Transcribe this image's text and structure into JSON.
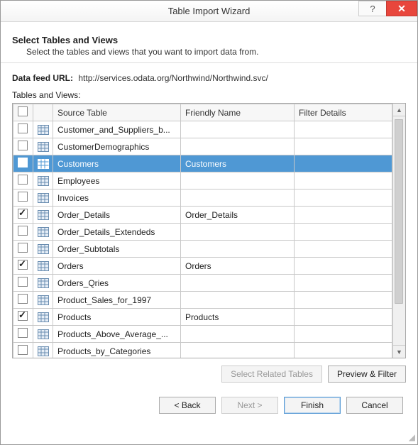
{
  "window": {
    "title": "Table Import Wizard"
  },
  "header": {
    "heading": "Select Tables and Views",
    "subheading": "Select the tables and views that you want to import data from."
  },
  "feed": {
    "label": "Data feed URL:",
    "value": "http://services.odata.org/Northwind/Northwind.svc/"
  },
  "list_label": "Tables and Views:",
  "columns": {
    "source": "Source Table",
    "friendly": "Friendly Name",
    "filter": "Filter Details"
  },
  "rows": [
    {
      "checked": false,
      "selected": false,
      "source": "Customer_and_Suppliers_b...",
      "friendly": "",
      "filter": ""
    },
    {
      "checked": false,
      "selected": false,
      "source": "CustomerDemographics",
      "friendly": "",
      "filter": ""
    },
    {
      "checked": true,
      "selected": true,
      "source": "Customers",
      "friendly": "Customers",
      "filter": ""
    },
    {
      "checked": false,
      "selected": false,
      "source": "Employees",
      "friendly": "",
      "filter": ""
    },
    {
      "checked": false,
      "selected": false,
      "source": "Invoices",
      "friendly": "",
      "filter": ""
    },
    {
      "checked": true,
      "selected": false,
      "source": "Order_Details",
      "friendly": "Order_Details",
      "filter": ""
    },
    {
      "checked": false,
      "selected": false,
      "source": "Order_Details_Extendeds",
      "friendly": "",
      "filter": ""
    },
    {
      "checked": false,
      "selected": false,
      "source": "Order_Subtotals",
      "friendly": "",
      "filter": ""
    },
    {
      "checked": true,
      "selected": false,
      "source": "Orders",
      "friendly": "Orders",
      "filter": ""
    },
    {
      "checked": false,
      "selected": false,
      "source": "Orders_Qries",
      "friendly": "",
      "filter": ""
    },
    {
      "checked": false,
      "selected": false,
      "source": "Product_Sales_for_1997",
      "friendly": "",
      "filter": ""
    },
    {
      "checked": true,
      "selected": false,
      "source": "Products",
      "friendly": "Products",
      "filter": ""
    },
    {
      "checked": false,
      "selected": false,
      "source": "Products_Above_Average_...",
      "friendly": "",
      "filter": ""
    },
    {
      "checked": false,
      "selected": false,
      "source": "Products_by_Categories",
      "friendly": "",
      "filter": ""
    }
  ],
  "buttons": {
    "select_related": "Select Related Tables",
    "preview_filter": "Preview & Filter",
    "back": "< Back",
    "next": "Next >",
    "finish": "Finish",
    "cancel": "Cancel"
  }
}
